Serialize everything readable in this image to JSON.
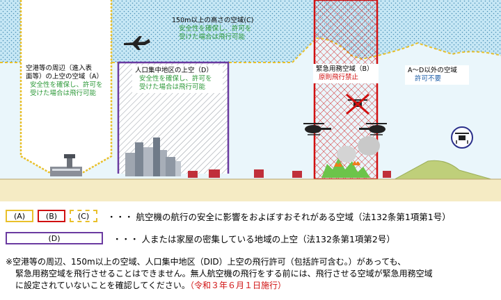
{
  "zones": {
    "c": {
      "title": "150m以上の高さの空域(C)",
      "note_line1": "安全性を確保し、許可を",
      "note_line2": "受けた場合は飛行可能"
    },
    "a": {
      "title_line1": "空港等の周辺（進入表",
      "title_line2": "面等）の上空の空域（A）",
      "note_line1": "安全性を確保し、許可を",
      "note_line2": "受けた場合は飛行可能"
    },
    "d": {
      "title": "人口集中地区の上空（D）",
      "note_line1": "安全性を確保し、許可を",
      "note_line2": "受けた場合は飛行可能"
    },
    "b": {
      "title": "緊急用務空域（B）",
      "note": "原則飛行禁止"
    },
    "other": {
      "title": "A～D以外の空域",
      "note": "許可不要"
    }
  },
  "legend": {
    "row1": {
      "boxes": [
        "(A)",
        "(B)",
        "(C)"
      ],
      "text": "・・・ 航空機の航行の安全に影響をおよぼすおそれがある空域（法132条第1項第1号）"
    },
    "row2": {
      "box": "(D)",
      "text": "・・・ 人または家屋の密集している地域の上空（法132条第1項第2号）"
    }
  },
  "footnote": {
    "line1": "※空港等の周辺、150m以上の空域、人口集中地区（DID）上空の飛行許可（包括許可含む。）があっても、",
    "line2": "緊急用務空域を飛行させることはできません。無人航空機の飛行をする前には、飛行させる空域が緊急用務空域",
    "line3": "に設定されていないことを確認してください。",
    "date": "（令和３年６月１日施行）"
  },
  "colors": {
    "zone_a": "#e9c02a",
    "zone_b": "#d01010",
    "zone_c": "#e9c02a",
    "zone_d": "#6a3aa0",
    "sky": "#bfe3f2",
    "ground": "#f5ebc4",
    "mountain": "#bfcf7a"
  },
  "icons": [
    "airplane-icon",
    "helicopter-icon",
    "drone-icon",
    "crossed-drone-icon",
    "airport-tower-icon",
    "fire-icon"
  ]
}
